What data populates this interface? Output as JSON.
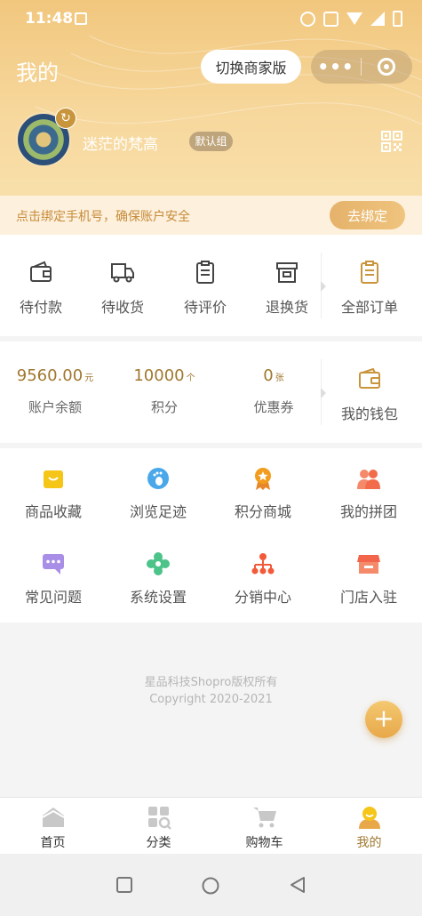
{
  "status_bar": {
    "time": "11:48"
  },
  "header": {
    "title": "我的",
    "switch_button": "切换商家版",
    "capsule_more": "•••"
  },
  "user": {
    "name": "迷茫的梵高",
    "tag": "默认组"
  },
  "bind_phone": {
    "text": "点击绑定手机号，确保账户安全",
    "button": "去绑定"
  },
  "orders": [
    {
      "label": "待付款",
      "icon": "wallet-icon"
    },
    {
      "label": "待收货",
      "icon": "truck-icon"
    },
    {
      "label": "待评价",
      "icon": "clipboard-icon"
    },
    {
      "label": "退换货",
      "icon": "box-icon"
    },
    {
      "label": "全部订单",
      "icon": "orders-icon"
    }
  ],
  "wallet": {
    "balance": {
      "value": "9560.00",
      "unit": "元",
      "label": "账户余额"
    },
    "points": {
      "value": "10000",
      "unit": "个",
      "label": "积分"
    },
    "coupons": {
      "value": "0",
      "unit": "张",
      "label": "优惠券"
    },
    "my_wallet": "我的钱包"
  },
  "tools": [
    {
      "label": "商品收藏",
      "icon": "favorites-icon",
      "color": "#f5c518"
    },
    {
      "label": "浏览足迹",
      "icon": "footprint-icon",
      "color": "#4aa8ea"
    },
    {
      "label": "积分商城",
      "icon": "medal-icon",
      "color": "#f29d1e"
    },
    {
      "label": "我的拼团",
      "icon": "group-icon",
      "color": "#f26b4b"
    },
    {
      "label": "常见问题",
      "icon": "faq-icon",
      "color": "#a98ee8"
    },
    {
      "label": "系统设置",
      "icon": "settings-icon",
      "color": "#4cc389"
    },
    {
      "label": "分销中心",
      "icon": "distribution-icon",
      "color": "#f25a3a"
    },
    {
      "label": "门店入驻",
      "icon": "store-icon",
      "color": "#f2654a"
    }
  ],
  "copyright": {
    "line1": "星品科技Shopro版权所有",
    "line2": "Copyright 2020-2021"
  },
  "fab": "+",
  "tabbar": [
    {
      "label": "首页",
      "icon": "home-icon"
    },
    {
      "label": "分类",
      "icon": "category-icon"
    },
    {
      "label": "购物车",
      "icon": "cart-icon"
    },
    {
      "label": "我的",
      "icon": "profile-icon",
      "active": true
    }
  ],
  "colors": {
    "accent": "#a0782f",
    "header": "#f3cf8c",
    "bind_bar": "#fdf0dc"
  }
}
